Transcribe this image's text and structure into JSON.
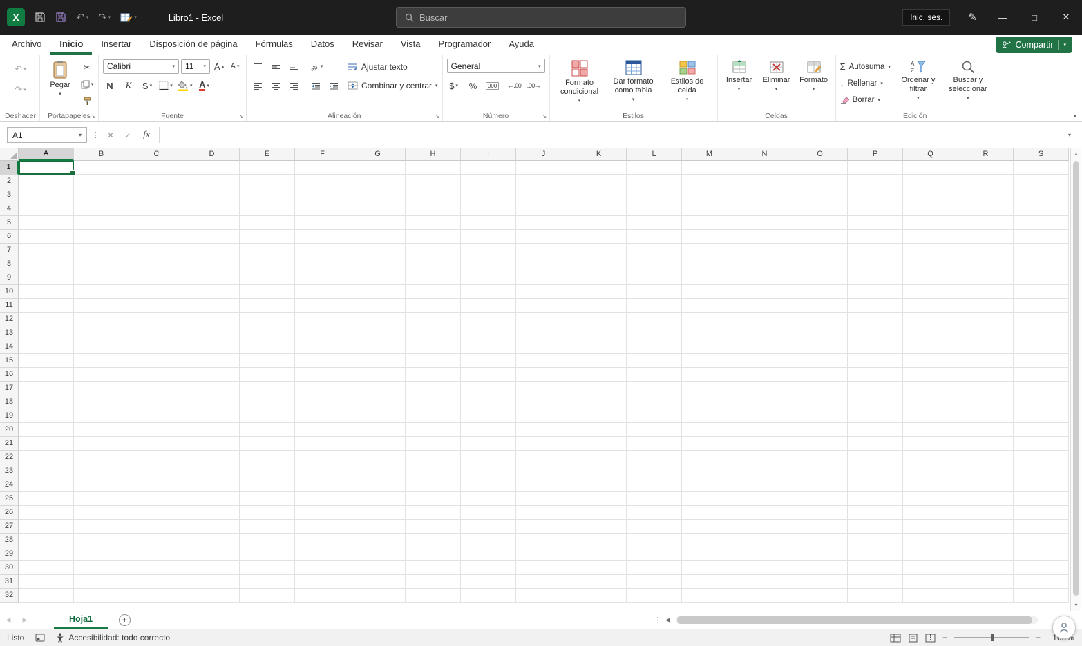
{
  "titlebar": {
    "app_icon_letter": "X",
    "title": "Libro1 - Excel",
    "search_placeholder": "Buscar",
    "sign_in": "Inic. ses."
  },
  "menu": {
    "tabs": [
      "Archivo",
      "Inicio",
      "Insertar",
      "Disposición de página",
      "Fórmulas",
      "Datos",
      "Revisar",
      "Vista",
      "Programador",
      "Ayuda"
    ],
    "active_tab": "Inicio",
    "share": "Compartir"
  },
  "ribbon": {
    "undo": {
      "label": "Deshacer"
    },
    "clipboard": {
      "label": "Portapapeles",
      "paste": "Pegar"
    },
    "font": {
      "label": "Fuente",
      "name": "Calibri",
      "size": "11",
      "bold": "N",
      "italic": "K",
      "underline": "S"
    },
    "alignment": {
      "label": "Alineación",
      "wrap": "Ajustar texto",
      "merge": "Combinar y centrar"
    },
    "number": {
      "label": "Número",
      "format": "General",
      "dollar": "$",
      "percent": "%",
      "thousands": "000",
      "inc_decimal": "←.00",
      "dec_decimal": ".00→"
    },
    "styles": {
      "label": "Estilos",
      "conditional": "Formato condicional",
      "as_table": "Dar formato como tabla",
      "cell_styles": "Estilos de celda"
    },
    "cells": {
      "label": "Celdas",
      "insert": "Insertar",
      "delete": "Eliminar",
      "format": "Formato"
    },
    "editing": {
      "label": "Edición",
      "autosum": "Autosuma",
      "fill": "Rellenar",
      "clear": "Borrar",
      "sort": "Ordenar y filtrar",
      "find": "Buscar y seleccionar"
    }
  },
  "formula_bar": {
    "name_box": "A1",
    "fx": "fx",
    "formula": ""
  },
  "sheet": {
    "columns": [
      "A",
      "B",
      "C",
      "D",
      "E",
      "F",
      "G",
      "H",
      "I",
      "J",
      "K",
      "L",
      "M",
      "N",
      "O",
      "P",
      "Q",
      "R",
      "S"
    ],
    "row_count": 32,
    "selected_cell": "A1",
    "active_sheet": "Hoja1"
  },
  "status_bar": {
    "mode": "Listo",
    "accessibility": "Accesibilidad: todo correcto",
    "zoom": "100%"
  },
  "icons": {
    "chevron": "▾",
    "chevron_up": "▴",
    "undo": "↶",
    "redo": "↷",
    "scissors": "✂",
    "sum": "Σ",
    "pen": "✎",
    "minimize": "—",
    "maximize": "□",
    "close": "✕",
    "cancel": "✕",
    "enter": "✓",
    "dots": "⋮",
    "launcher": "↘",
    "nav_left": "◀",
    "nav_right": "▶",
    "add": "+",
    "zoom_out": "−",
    "zoom_in": "+",
    "fill_arrow": "↓",
    "letter_a": "A"
  },
  "colors": {
    "excel_green": "#107c41",
    "tab_green": "#217346",
    "selection_green": "#1a6e3c"
  }
}
